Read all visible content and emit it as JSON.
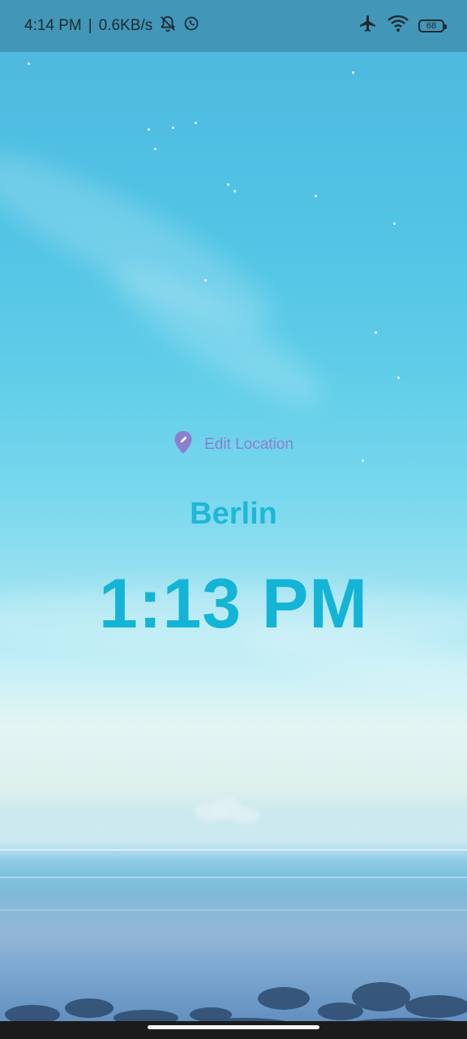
{
  "status_bar": {
    "time": "4:14 PM",
    "separator": "|",
    "network_speed": "0.6KB/s",
    "notification_icons": [
      "bell-off-icon",
      "whatsapp-icon"
    ],
    "system_icons": [
      "airplane-icon",
      "wifi-icon",
      "battery-icon"
    ],
    "battery_level": "68"
  },
  "main": {
    "edit_location_icon": "location-pin-icon",
    "edit_location_label": "Edit Location",
    "city": "Berlin",
    "time": "1:13 PM"
  },
  "colors": {
    "accent_purple": "#8b7fd0",
    "city_color": "#1fb7d8",
    "time_color": "#13b4d6"
  }
}
